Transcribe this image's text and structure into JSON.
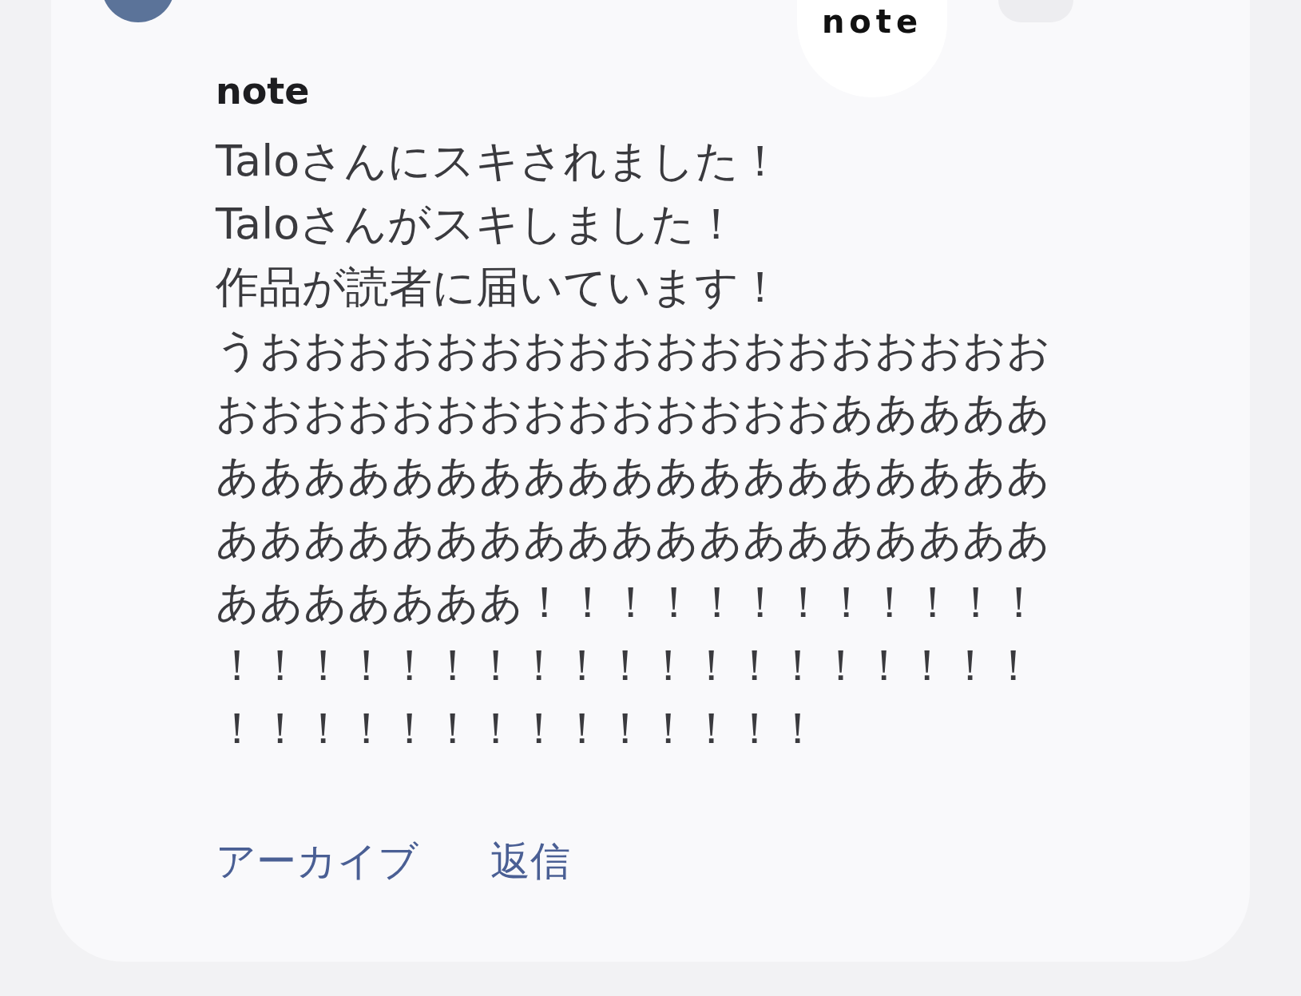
{
  "notification": {
    "logo": "note",
    "title": "note",
    "message_lines": [
      "Taloさんにスキされました！",
      "Taloさんがスキしました！",
      "作品が読者に届いています！",
      "うおおおおおおおおおおおおおおおおおお",
      "おおおおおおおおおおおおおおあああああ",
      "あああああああああああああああああああ",
      "あああああああああああああああああああ",
      "あああああああ！！！！！！！！！！！！",
      "！！！！！！！！！！！！！！！！！！！",
      "！！！！！！！！！！！！！！"
    ],
    "actions": [
      "アーカイブ",
      "返信"
    ]
  }
}
